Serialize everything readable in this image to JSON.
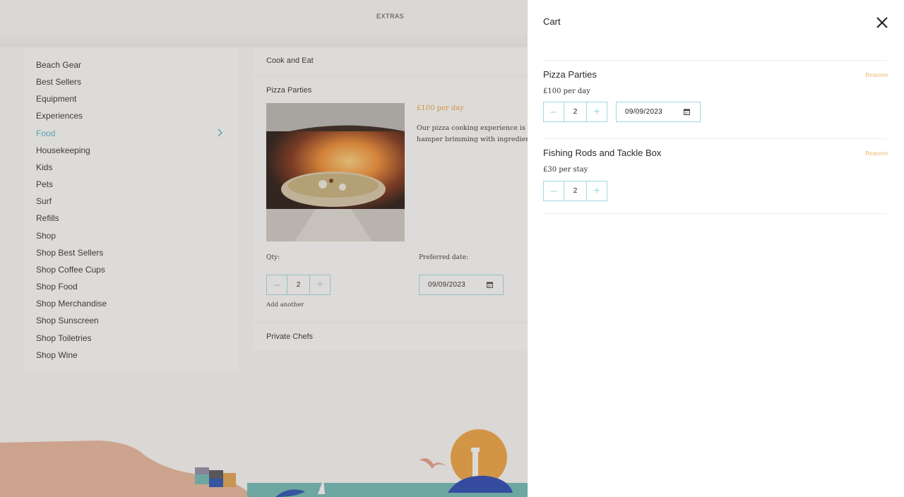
{
  "header": {
    "title": "EXTRAS"
  },
  "categories": [
    {
      "label": "Beach Gear",
      "active": false
    },
    {
      "label": "Best Sellers",
      "active": false
    },
    {
      "label": "Equipment",
      "active": false
    },
    {
      "label": "Experiences",
      "active": false
    },
    {
      "label": "Food",
      "active": true
    },
    {
      "label": "Housekeeping",
      "active": false
    },
    {
      "label": "Kids",
      "active": false
    },
    {
      "label": "Pets",
      "active": false
    },
    {
      "label": "Surf",
      "active": false
    },
    {
      "label": "Refills",
      "active": false
    },
    {
      "label": "Shop",
      "active": false
    },
    {
      "label": "Shop Best Sellers",
      "active": false
    },
    {
      "label": "Shop Coffee Cups",
      "active": false
    },
    {
      "label": "Shop Food",
      "active": false
    },
    {
      "label": "Shop Merchandise",
      "active": false
    },
    {
      "label": "Shop Sunscreen",
      "active": false
    },
    {
      "label": "Shop Toiletries",
      "active": false
    },
    {
      "label": "Shop Wine",
      "active": false
    }
  ],
  "products": {
    "cook_and_eat": "Cook and Eat",
    "pizza": {
      "title": "Pizza Parties",
      "price": "£100 per day",
      "desc_line1": "Our pizza cooking experience is i",
      "desc_line2": "hamper brimming with ingredier",
      "qty_label": "Qty:",
      "date_label": "Preferred date:",
      "qty": "2",
      "date": "09/09/2023",
      "add_another": "Add another"
    },
    "private_chefs": "Private Chefs"
  },
  "cart": {
    "title": "Cart",
    "remove_label": "Remove",
    "items": [
      {
        "name": "Pizza Parties",
        "price": "£100 per day",
        "qty": "2",
        "date": "09/09/2023"
      },
      {
        "name": "Fishing Rods and Tackle Box",
        "price": "£30 per stay",
        "qty": "2"
      }
    ]
  },
  "colors": {
    "accent": "#4fb3c4",
    "border": "#9fd8e2",
    "orange": "#f0a23b",
    "remove": "#f0b56a"
  }
}
